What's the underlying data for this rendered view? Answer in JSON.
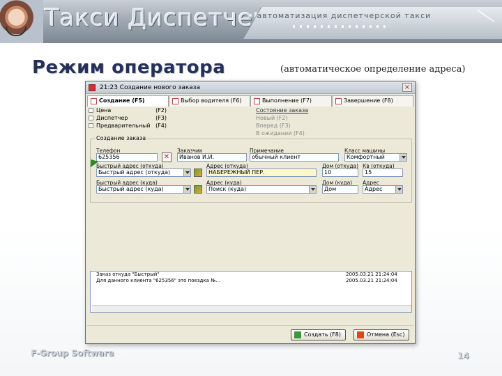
{
  "header": {
    "brand": "Такси Диспетчер",
    "tagline": "автоматизация диспетчерской такси"
  },
  "slide": {
    "title": "Режим оператора",
    "subtitle": "(автоматическое определение адреса)",
    "footer": "F-Group Software",
    "page_number": "14"
  },
  "window": {
    "title": "21:23 Создание нового заказа",
    "close": "×",
    "tabs": [
      "Создание (F5)",
      "Выбор водителя (F6)",
      "Выполнение (F7)",
      "Завершение (F8)"
    ],
    "left_list": [
      {
        "label": "Цена",
        "key": "(F2)"
      },
      {
        "label": "Диспетчер",
        "key": "(F3)"
      },
      {
        "label": "Предварительный",
        "key": "(F4)"
      }
    ],
    "right_list": {
      "header": "Состояние заказа",
      "items": [
        {
          "label": "Новый",
          "key": "(F2)"
        },
        {
          "label": "Вперед",
          "key": "(F3)"
        },
        {
          "label": "В ожидании",
          "key": "(F4)"
        }
      ]
    },
    "group_label": "Создание заказа",
    "fields": {
      "phone": {
        "label": "Телефон",
        "value": "625356"
      },
      "customer": {
        "label": "Заказчик",
        "value": "Иванов И.И."
      },
      "note": {
        "label": "Примечание",
        "value": "обычный клиент"
      },
      "car_class": {
        "label": "Класс машины",
        "value": "Комфортный"
      },
      "quick_from": {
        "label": "Быстрый адрес (откуда)",
        "value": "Быстрый адрес (откуда)"
      },
      "address_from": {
        "label": "Адрес (откуда)",
        "value": "НАБЕРЕЖНЫЙ ПЕР."
      },
      "house_from": {
        "label": "Дом (откуда)",
        "value": "10"
      },
      "apt_from": {
        "label": "Кв (откуда)",
        "value": "15"
      },
      "quick_to": {
        "label": "Быстрый адрес (куда)",
        "value": "Быстрый адрес (куда)"
      },
      "address_to": {
        "label": "Адрес (куда)",
        "value": "Поиск (куда)"
      },
      "house_to": {
        "label": "Дом (куда)",
        "value": "Дом"
      },
      "where": {
        "label": "Адрес",
        "value": "Адрес"
      }
    },
    "log": [
      {
        "text": "Заказ откуда \"Быстрый\"",
        "time": "2005.03.21 21:24:04"
      },
      {
        "text": "Для данного клиента \"625356\" это поездка №...",
        "time": "2005.03.21 21:24:04"
      }
    ],
    "buttons": {
      "create": "Создать (F8)",
      "cancel": "Отмена (Esc)"
    }
  }
}
